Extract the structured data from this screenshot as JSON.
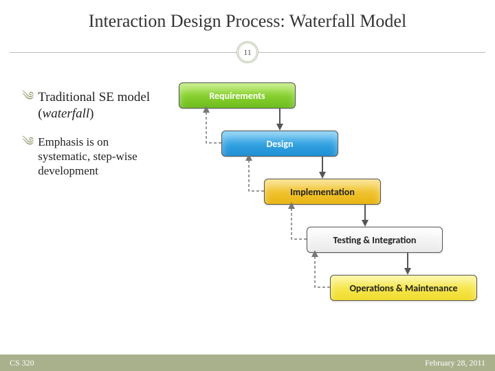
{
  "title": "Interaction Design Process: Waterfall Model",
  "page_number": "11",
  "bullets": {
    "main_prefix": "Traditional SE model (",
    "main_italic": "waterfall",
    "main_suffix": ")",
    "sub": "Emphasis is on systematic, step-wise development"
  },
  "chart_data": {
    "type": "diagram",
    "title": "Waterfall Model",
    "stages": [
      {
        "label": "Requirements",
        "color": "green"
      },
      {
        "label": "Design",
        "color": "blue"
      },
      {
        "label": "Implementation",
        "color": "orange"
      },
      {
        "label": "Testing & Integration",
        "color": "white"
      },
      {
        "label": "Operations & Maintenance",
        "color": "yellow"
      }
    ],
    "forward_edges": [
      [
        0,
        1
      ],
      [
        1,
        2
      ],
      [
        2,
        3
      ],
      [
        3,
        4
      ]
    ],
    "feedback_edges": [
      [
        1,
        0
      ],
      [
        2,
        1
      ],
      [
        3,
        2
      ],
      [
        4,
        3
      ]
    ]
  },
  "footer": {
    "left": "CS 320",
    "right": "February 28, 2011"
  }
}
